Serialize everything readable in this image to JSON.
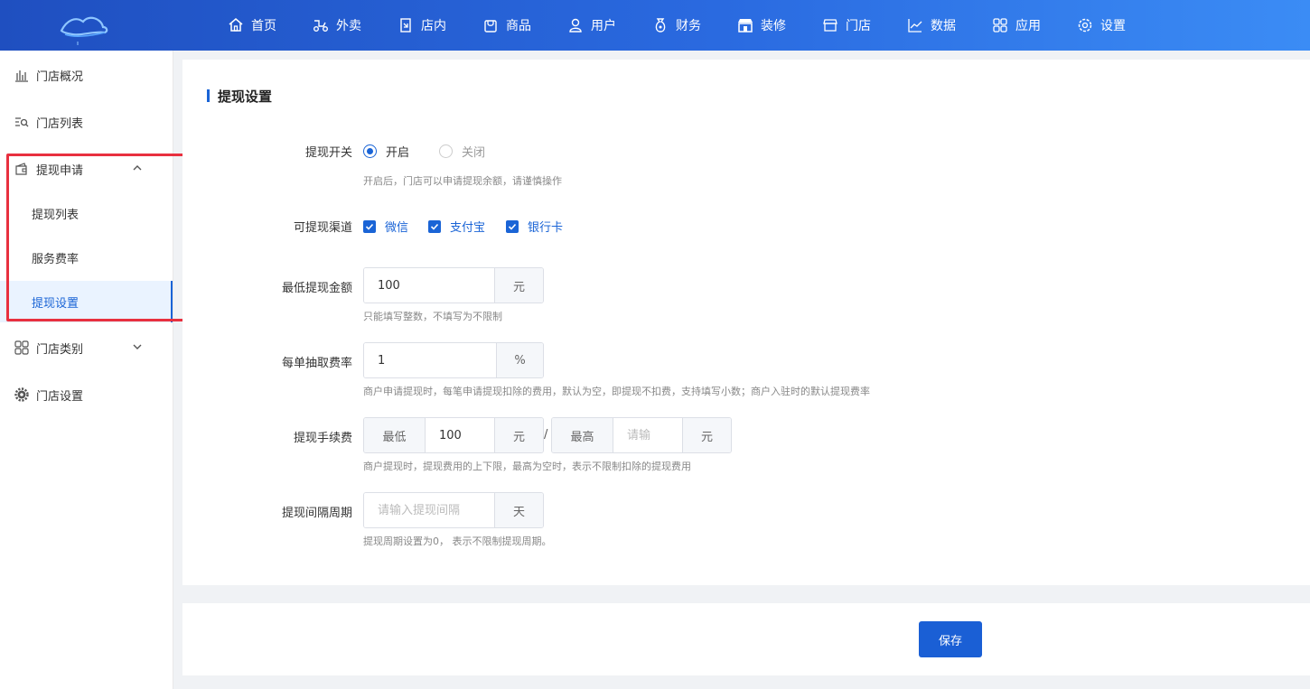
{
  "nav": [
    {
      "label": "首页",
      "icon": "home-icon"
    },
    {
      "label": "外卖",
      "icon": "scooter-icon"
    },
    {
      "label": "店内",
      "icon": "dine-in-icon"
    },
    {
      "label": "商品",
      "icon": "shopping-bag-icon"
    },
    {
      "label": "用户",
      "icon": "user-icon"
    },
    {
      "label": "财务",
      "icon": "money-bag-icon"
    },
    {
      "label": "装修",
      "icon": "storefront-icon"
    },
    {
      "label": "门店",
      "icon": "shop-icon"
    },
    {
      "label": "数据",
      "icon": "line-chart-icon"
    },
    {
      "label": "应用",
      "icon": "apps-grid-icon"
    },
    {
      "label": "设置",
      "icon": "gear-icon"
    }
  ],
  "sidebar": {
    "items": [
      {
        "label": "门店概况",
        "icon": "bar-chart-icon"
      },
      {
        "label": "门店列表",
        "icon": "list-search-icon"
      },
      {
        "label": "提现申请",
        "icon": "wallet-icon",
        "expanded": true
      },
      {
        "label": "门店类别",
        "icon": "category-grid-icon",
        "expanded": false
      },
      {
        "label": "门店设置",
        "icon": "gear-icon"
      }
    ],
    "sub_items": [
      {
        "label": "提现列表",
        "active": false
      },
      {
        "label": "服务费率",
        "active": false
      },
      {
        "label": "提现设置",
        "active": true
      }
    ]
  },
  "page": {
    "title": "提现设置",
    "form": {
      "switch": {
        "label": "提现开关",
        "options": [
          "开启",
          "关闭"
        ],
        "selected": "开启",
        "help": "开启后，门店可以申请提现余额，请谨慎操作"
      },
      "channels": {
        "label": "可提现渠道",
        "options": [
          {
            "label": "微信",
            "checked": true
          },
          {
            "label": "支付宝",
            "checked": true
          },
          {
            "label": "银行卡",
            "checked": true
          }
        ]
      },
      "min_amount": {
        "label": "最低提现金额",
        "value": "100",
        "unit": "元",
        "help": "只能填写整数，不填写为不限制"
      },
      "fee_rate": {
        "label": "每单抽取费率",
        "value": "1",
        "unit": "%",
        "help": "商户申请提现时，每笔申请提现扣除的费用，默认为空，即提现不扣费，支持填写小数；商户入驻时的默认提现费率"
      },
      "fee_range": {
        "label": "提现手续费",
        "min_prefix": "最低",
        "min_value": "100",
        "min_unit": "元",
        "separator": "/",
        "max_prefix": "最高",
        "max_placeholder": "请输",
        "max_unit": "元",
        "help": "商户提现时，提现费用的上下限，最高为空时，表示不限制扣除的提现费用"
      },
      "interval": {
        "label": "提现间隔周期",
        "placeholder": "请输入提现间隔",
        "unit": "天",
        "help": "提现周期设置为0， 表示不限制提现周期。"
      }
    },
    "save_label": "保存"
  },
  "colors": {
    "primary": "#1a64d6",
    "highlight_box": "#e8303f"
  }
}
